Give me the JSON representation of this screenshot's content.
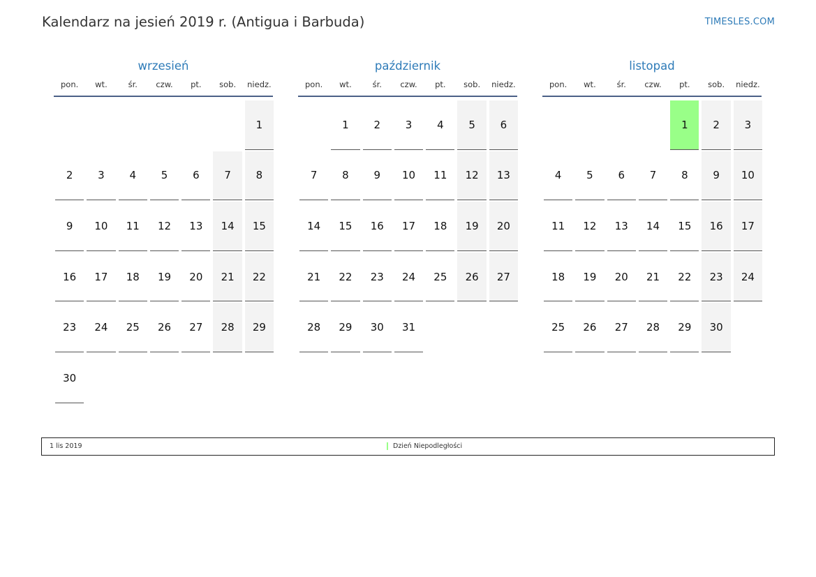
{
  "title": "Kalendarz na jesień 2019 r. (Antigua i Barbuda)",
  "site": "TIMESLES.COM",
  "weekdays": [
    "pon.",
    "wt.",
    "śr.",
    "czw.",
    "pt.",
    "sob.",
    "niedz."
  ],
  "months": [
    {
      "name": "wrzesień",
      "offset": 6,
      "days": 30,
      "holidays": []
    },
    {
      "name": "październik",
      "offset": 1,
      "days": 31,
      "holidays": []
    },
    {
      "name": "listopad",
      "offset": 4,
      "days": 30,
      "holidays": [
        1
      ]
    }
  ],
  "legend": {
    "date": "1 lis 2019",
    "name": "Dzień Niepodległości"
  },
  "colors": {
    "accent": "#2e7bb8",
    "holiday": "#99ff88",
    "weekend": "#f3f3f3"
  }
}
